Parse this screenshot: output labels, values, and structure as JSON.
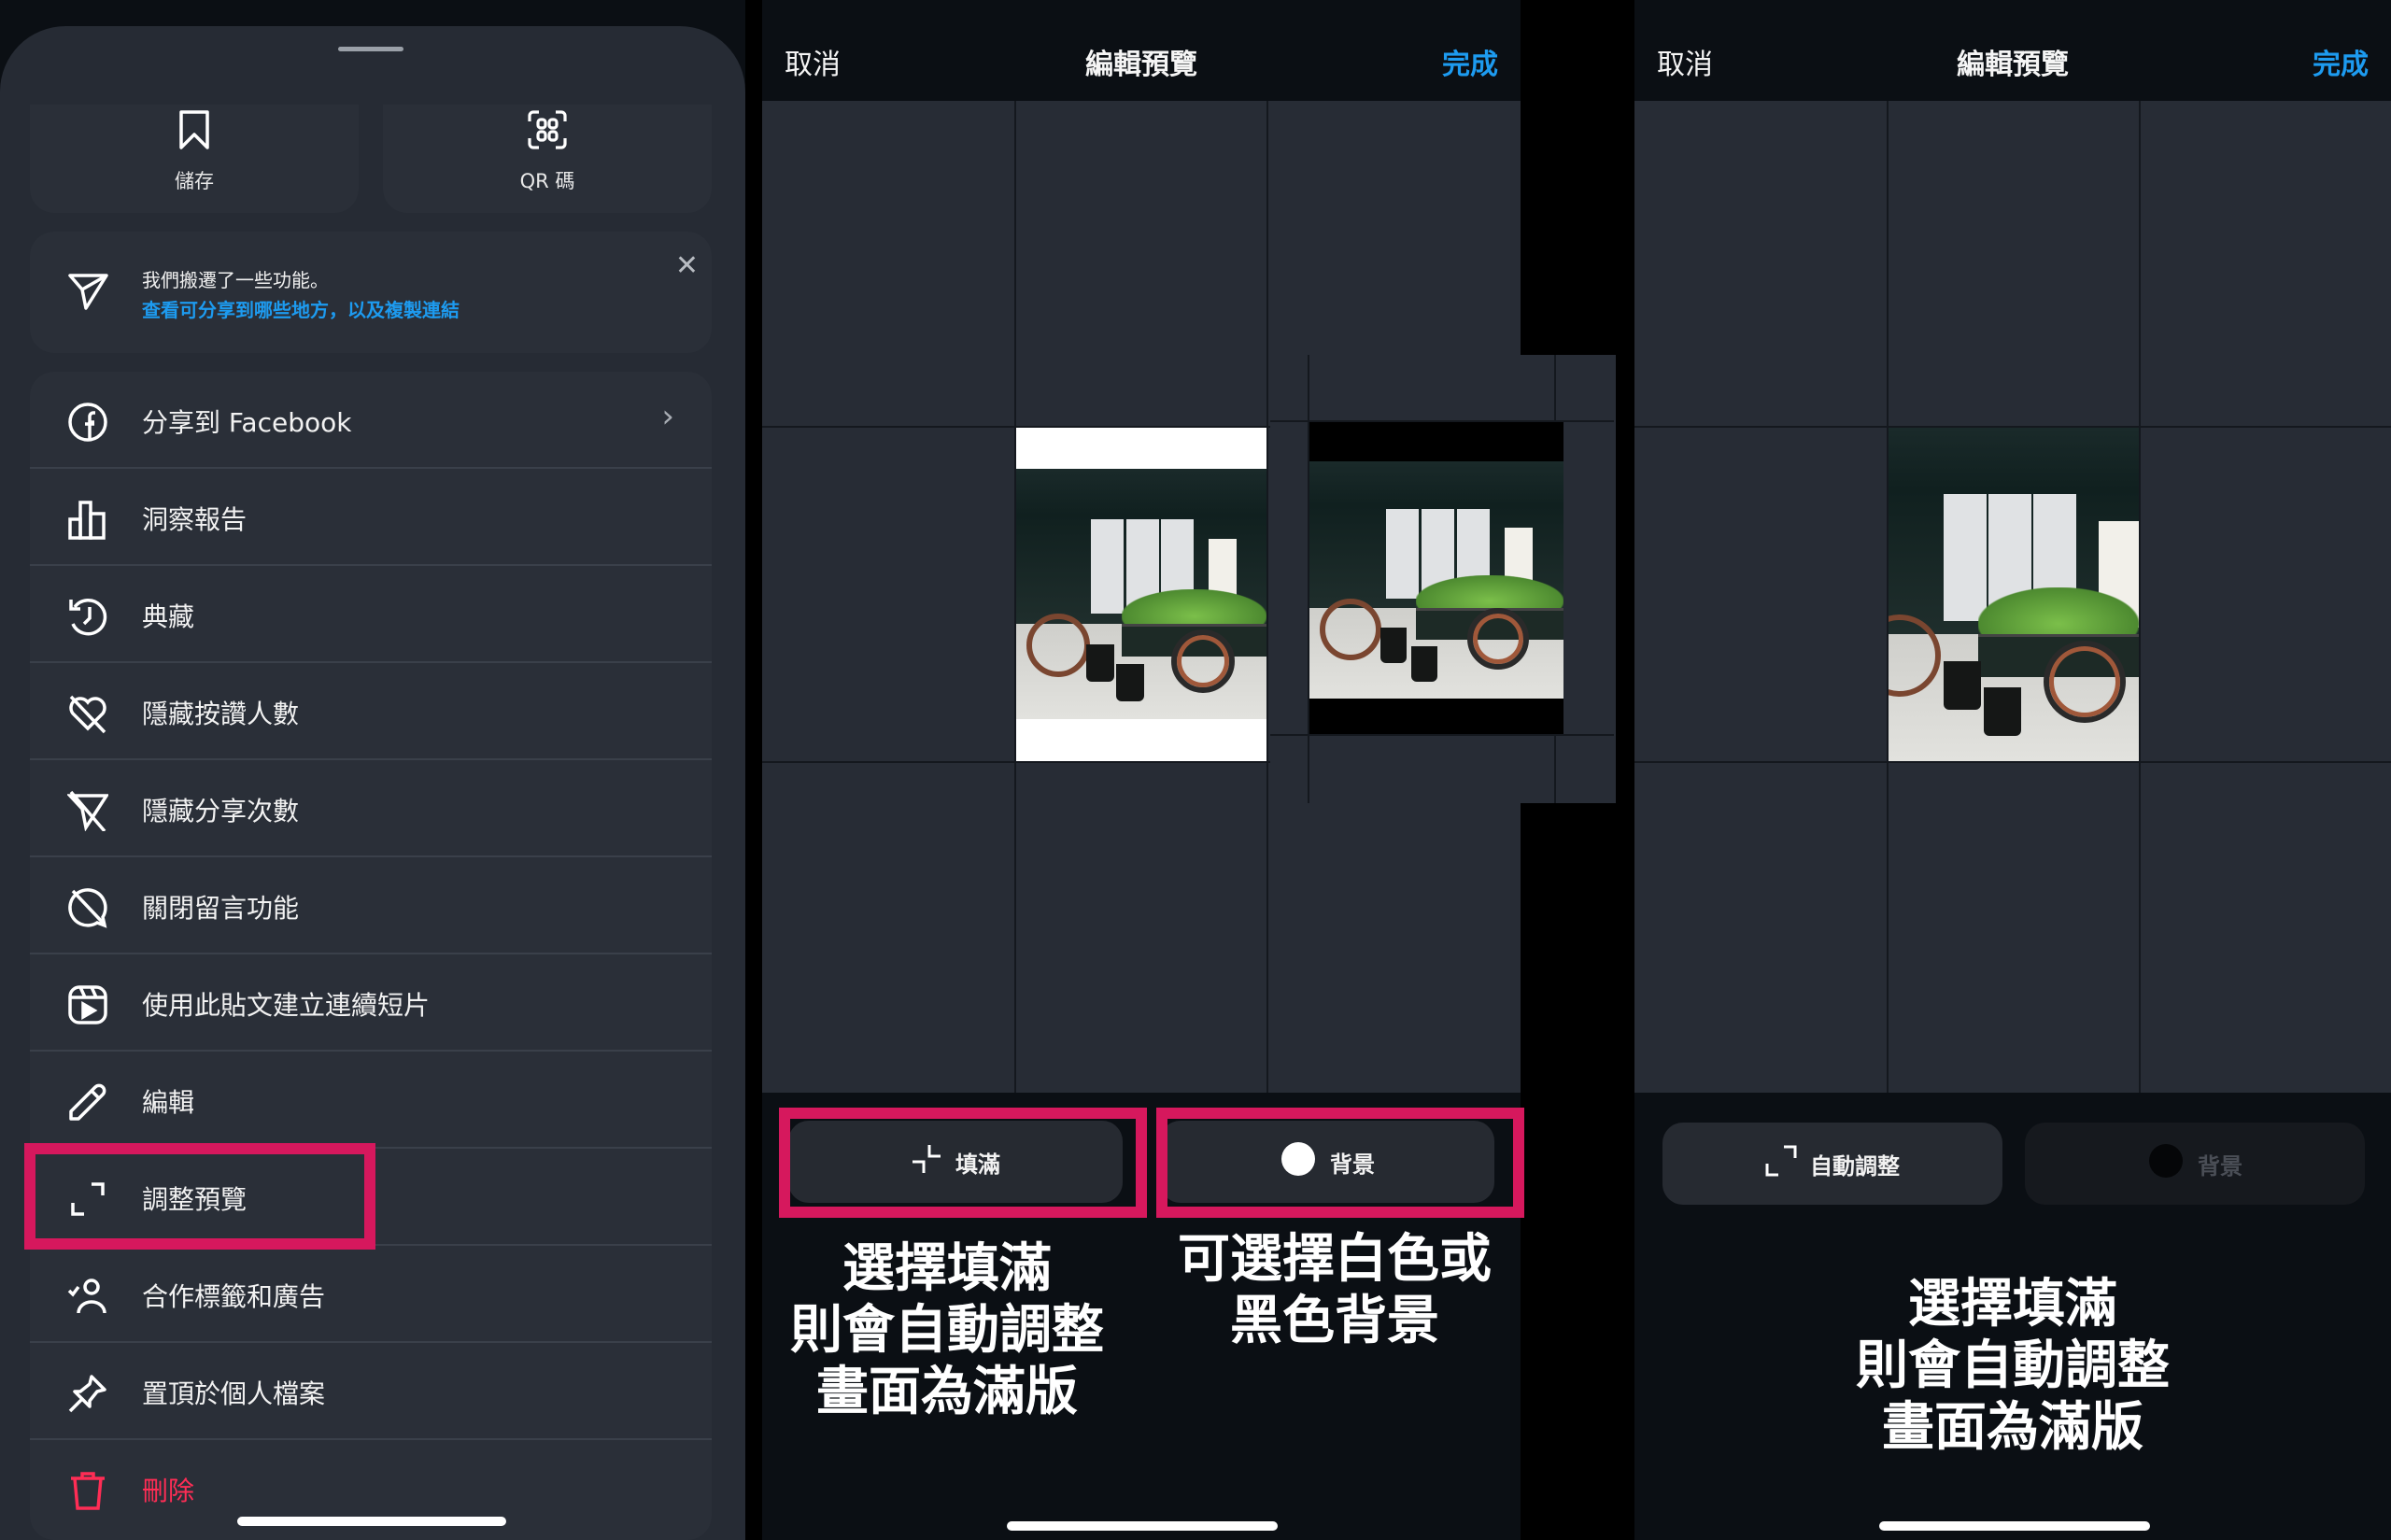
{
  "left_panel": {
    "tiles": [
      {
        "label": "儲存",
        "icon": "bookmark-icon"
      },
      {
        "label": "QR 碼",
        "icon": "qr-code-icon"
      }
    ],
    "notice": {
      "line1": "我們搬遷了一些功能。",
      "line2": "查看可分享到哪些地方，以及複製連結",
      "icon": "send-icon",
      "close": "✕"
    },
    "menu": [
      {
        "label": "分享到 Facebook",
        "icon": "facebook-icon",
        "chevron": "›"
      },
      {
        "label": "洞察報告",
        "icon": "bar-chart-icon"
      },
      {
        "label": "典藏",
        "icon": "archive-history-icon"
      },
      {
        "label": "隱藏按讚人數",
        "icon": "heart-off-icon"
      },
      {
        "label": "隱藏分享次數",
        "icon": "share-off-icon"
      },
      {
        "label": "關閉留言功能",
        "icon": "comment-off-icon"
      },
      {
        "label": "使用此貼文建立連續短片",
        "icon": "reels-icon"
      },
      {
        "label": "編輯",
        "icon": "pencil-icon"
      },
      {
        "label": "調整預覽",
        "icon": "expand-icon",
        "highlighted": true
      },
      {
        "label": "合作標籤和廣告",
        "icon": "tag-person-icon"
      },
      {
        "label": "置頂於個人檔案",
        "icon": "pin-icon"
      },
      {
        "label": "刪除",
        "icon": "trash-icon",
        "danger": true
      }
    ]
  },
  "middle_panel": {
    "header": {
      "cancel": "取消",
      "title": "編輯預覽",
      "done": "完成"
    },
    "buttons": {
      "fill": "填滿",
      "background": "背景"
    },
    "captions": {
      "fill": "選擇填滿\n則會自動調整\n畫面為滿版",
      "background": "可選擇白色或\n黑色背景"
    }
  },
  "right_panel": {
    "header": {
      "cancel": "取消",
      "title": "編輯預覽",
      "done": "完成"
    },
    "buttons": {
      "auto_adjust": "自動調整",
      "background": "背景"
    },
    "caption": "選擇填滿\n則會自動調整\n畫面為滿版"
  },
  "colors": {
    "accent_blue": "#1d9bf0",
    "highlight_pink": "#d6185d",
    "danger_red": "#ff2d55",
    "sheet_bg": "#262b34"
  }
}
